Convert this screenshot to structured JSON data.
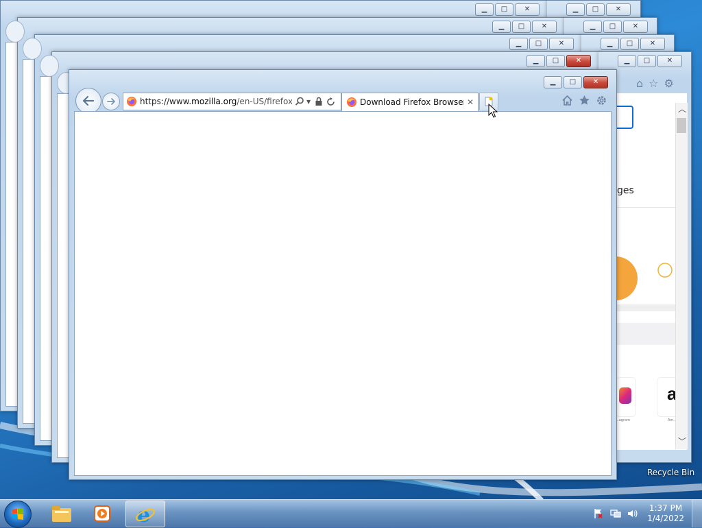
{
  "front_window": {
    "address_url_prefix": "https://www.",
    "address_url_domain": "mozilla.org",
    "address_url_rest": "/en-US/firefox/ne",
    "tab_title": "Download Firefox Browser ..."
  },
  "background_page": {
    "heading_fragment": "ges",
    "tile_caption_left": "...agram",
    "tile_caption_right": "Am..."
  },
  "desktop": {
    "recycle_bin_label": "Recycle Bin"
  },
  "taskbar": {
    "time": "1:37 PM",
    "date": "1/4/2022"
  },
  "colors": {
    "orange_accent": "#f4a53c",
    "teal_accent": "#1aa7e0"
  },
  "icons": {
    "search": "search-icon",
    "lock": "lock-icon",
    "refresh": "refresh-icon",
    "home": "home-icon",
    "favorites": "star-icon",
    "tools": "gear-icon"
  }
}
